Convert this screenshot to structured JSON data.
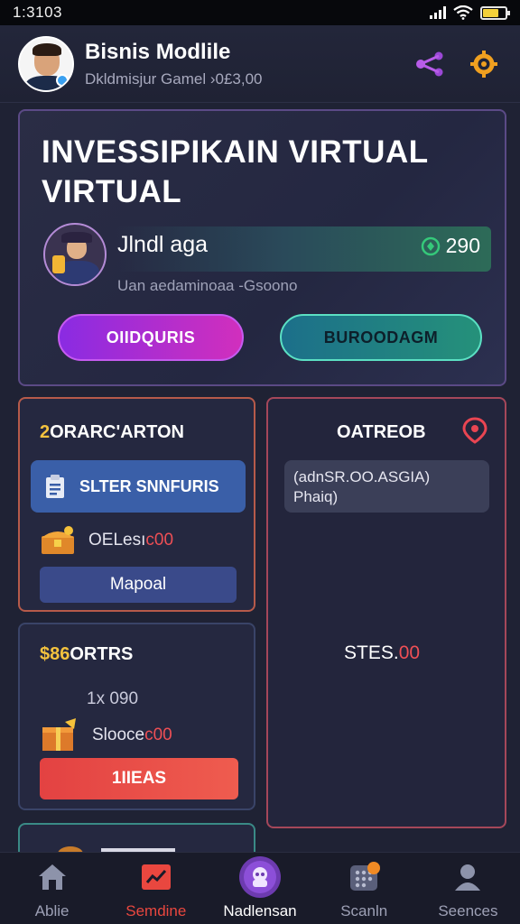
{
  "status_bar": {
    "time": "1:3103"
  },
  "header": {
    "title": "Bisnis Modlile",
    "subtitle": "Dkldmisjur Gamel  ›0£3,00",
    "icons": [
      "share-icon",
      "settings-gear-icon"
    ]
  },
  "hero": {
    "title": "INVESSIPIKAIN VIRTUAL VIRTUAL",
    "player_name": "Jlndl aga",
    "player_value": "290",
    "caption": "Uan aedaminoaa -Gsoono",
    "primary_button": "OIIDQURIS",
    "secondary_button": "BUROODAGM"
  },
  "card_a": {
    "title_accent": "2",
    "title_rest": "ORARC'ARTON",
    "inner_button": "SLTER SNNFURIS",
    "row_text": "OELesı",
    "row_accent": "c00",
    "action_button": "Mapoal"
  },
  "card_b": {
    "title": "OATREOB",
    "info_line1": "(adnSR.OO.ASGIA)",
    "info_line2": "Phaiq)",
    "bottom_value_prefix": "STES.",
    "bottom_value_accent": "00"
  },
  "card_c": {
    "title_accent": "$86",
    "title_rest": "ORTRS",
    "sub_line": "1x 090",
    "row_text": "Slooce",
    "row_accent": "c00",
    "action_button": "1IIEAS"
  },
  "bottom_nav": [
    {
      "label": "Ablie",
      "icon": "home-icon"
    },
    {
      "label": "Semdine",
      "icon": "chart-icon"
    },
    {
      "label": "Nadlensan",
      "icon": "game-icon"
    },
    {
      "label": "Scanln",
      "icon": "grid-icon"
    },
    {
      "label": "Seences",
      "icon": "profile-icon"
    }
  ],
  "colors": {
    "background": "#1f2234",
    "primary_gradient_start": "#8a2be2",
    "primary_gradient_end": "#d12fbd",
    "secondary_accent": "#5be0c3",
    "accent_red": "#ee4f55",
    "accent_yellow": "#f3c23e"
  }
}
